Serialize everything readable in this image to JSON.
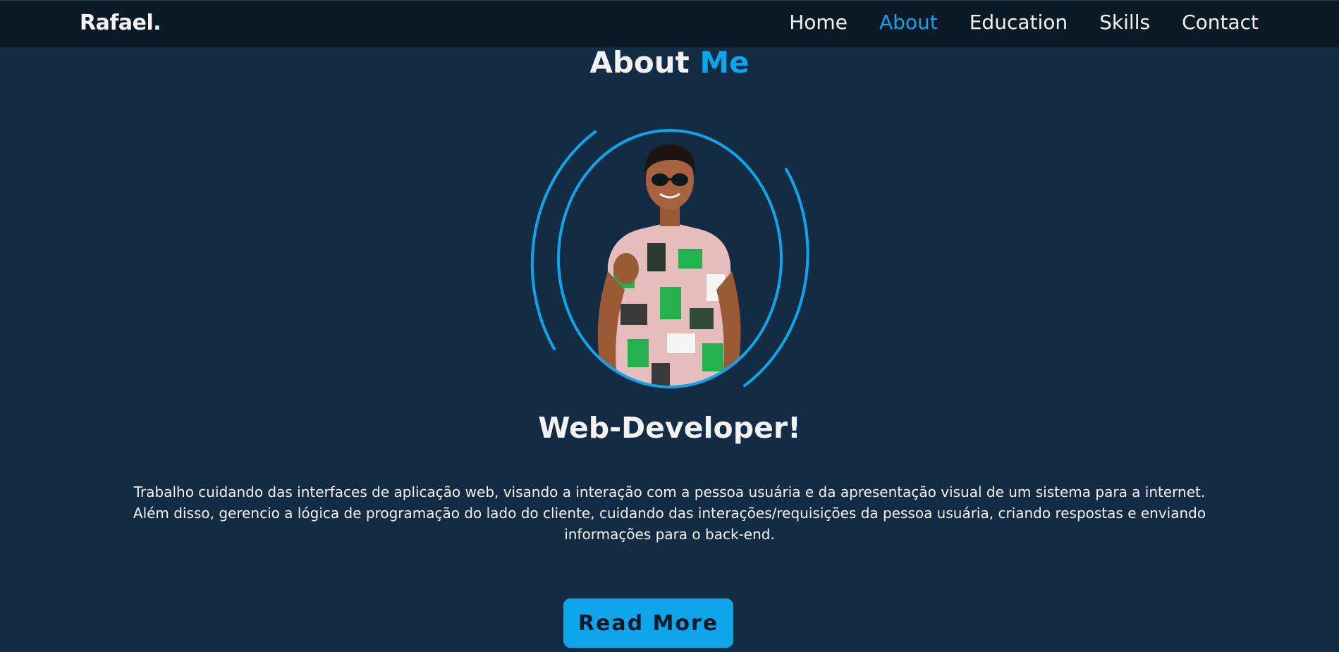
{
  "navbar": {
    "logo": "Rafael.",
    "links": [
      {
        "label": "Home",
        "active": false
      },
      {
        "label": "About",
        "active": true
      },
      {
        "label": "Education",
        "active": false
      },
      {
        "label": "Skills",
        "active": false
      },
      {
        "label": "Contact",
        "active": false
      }
    ]
  },
  "about": {
    "title_main": "About",
    "title_accent": "Me",
    "role": "Web-Developer!",
    "description_line1": "Trabalho cuidando das interfaces de aplicação web, visando a interação com a pessoa usuária e da apresentação visual de um sistema para a internet.",
    "description_line2": "Além disso, gerencio a lógica de programação do lado do cliente, cuidando das interações/requisições da pessoa usuária, criando respostas e enviando informações para o back-end.",
    "read_more_label": "Read More",
    "portrait_icon": "profile-photo"
  },
  "colors": {
    "background": "#132b43",
    "navbar": "#0a1a27",
    "accent": "#0ea5ea",
    "text": "#f2f2f2"
  }
}
